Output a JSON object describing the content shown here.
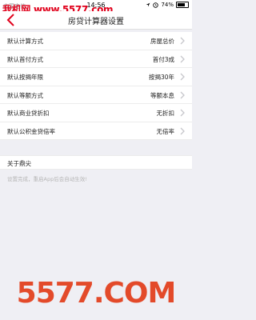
{
  "status_bar": {
    "carrier": "中国电信",
    "time": "14:56",
    "battery_percent": "74%",
    "battery_level": 0.74
  },
  "nav": {
    "title": "房贷计算器设置"
  },
  "watermark": {
    "top": "我机网 www.5577.com",
    "bottom": "5577.COM"
  },
  "settings": [
    {
      "label": "默认计算方式",
      "value": "房屋总价"
    },
    {
      "label": "默认首付方式",
      "value": "首付3成"
    },
    {
      "label": "默认按揭年限",
      "value": "按揭30年"
    },
    {
      "label": "默认等额方式",
      "value": "等额本息"
    },
    {
      "label": "默认商业贷折扣",
      "value": "无折扣"
    },
    {
      "label": "默认公积金贷倍率",
      "value": "无倍率"
    }
  ],
  "about": {
    "label": "关于鼎尖"
  },
  "hint": "设置完成，重启App后会自动生效!",
  "colors": {
    "accent": "#e0001b",
    "background": "#efeff4",
    "hint": "#b6b6b6"
  }
}
